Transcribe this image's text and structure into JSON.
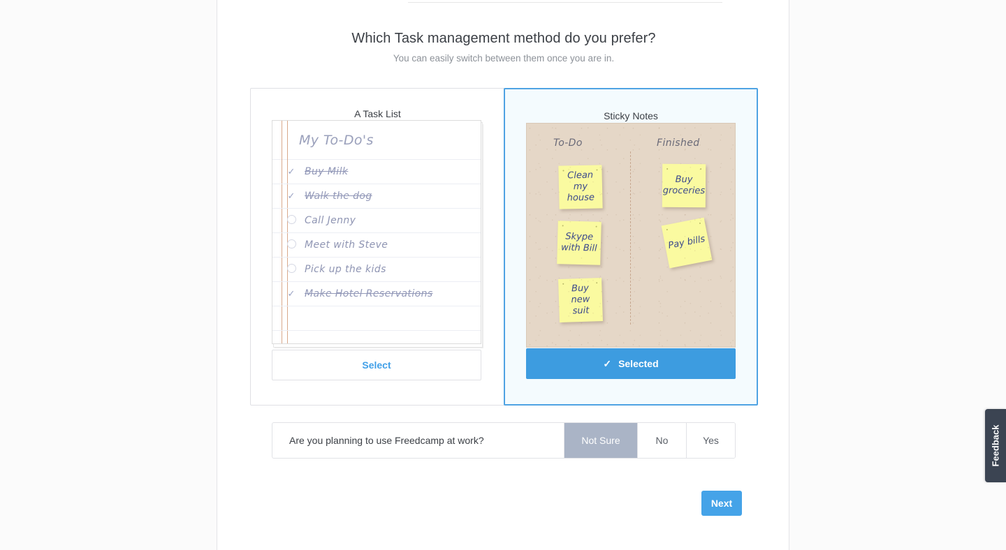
{
  "header": {
    "title": "Which Task management method do you prefer?",
    "subtitle": "You can easily switch between them once you are in."
  },
  "options": {
    "task_list": {
      "title": "A Task List",
      "notepad": {
        "heading": "My To-Do's",
        "rows": [
          {
            "label": "Buy Milk",
            "done": true
          },
          {
            "label": "Walk the dog",
            "done": true
          },
          {
            "label": "Call Jenny",
            "done": false
          },
          {
            "label": "Meet with Steve",
            "done": false
          },
          {
            "label": "Pick up the kids",
            "done": false
          },
          {
            "label": "Make Hotel Reservations",
            "done": true
          }
        ],
        "check_glyph": "✓"
      },
      "button_label": "Select",
      "selected": false
    },
    "sticky_notes": {
      "title": "Sticky Notes",
      "board": {
        "columns": [
          "To-Do",
          "Finished"
        ],
        "notes": [
          {
            "text": "Clean my house",
            "column": "To-Do"
          },
          {
            "text": "Skype with Bill",
            "column": "To-Do"
          },
          {
            "text": "Buy new suit",
            "column": "To-Do"
          },
          {
            "text": "Buy groceries",
            "column": "Finished"
          },
          {
            "text": "Pay bills",
            "column": "Finished"
          }
        ]
      },
      "button_label": "Selected",
      "check_glyph": "✓",
      "selected": true
    }
  },
  "work_question": {
    "text": "Are you planning to use Freedcamp at work?",
    "answers": [
      {
        "label": "Not Sure",
        "selected": true
      },
      {
        "label": "No",
        "selected": false
      },
      {
        "label": "Yes",
        "selected": false
      }
    ]
  },
  "next_button": {
    "label": "Next"
  },
  "feedback_tab": {
    "label": "Feedback"
  },
  "colors": {
    "accent_blue": "#45a3e8",
    "selected_border": "#4fa3e3",
    "selected_fill": "#f4fbfe",
    "answer_selected": "#aab4c6",
    "board_bg": "#e5d7c7",
    "note_yellow": "#fafaa0",
    "note_ink": "#3d4a8c",
    "feedback_bg": "#3b4452"
  }
}
